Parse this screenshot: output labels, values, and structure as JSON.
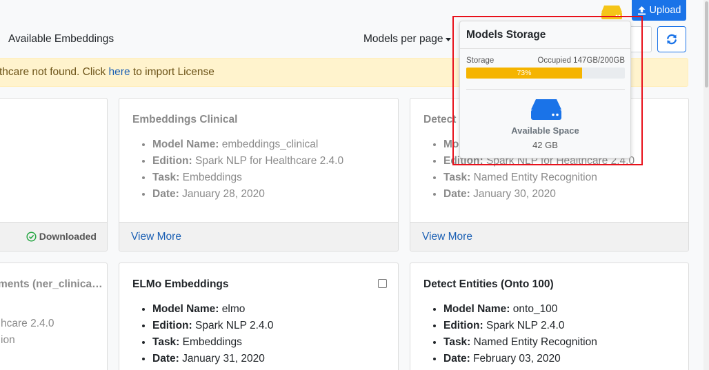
{
  "header": {
    "section_title": "Available Embeddings",
    "per_page_label": "Models per page",
    "upload_label": "Upload"
  },
  "alert": {
    "prefix": "thcare not found. Click ",
    "link": "here",
    "suffix": " to import License"
  },
  "cards": [
    {
      "title": "",
      "items": [],
      "status": "Downloaded"
    },
    {
      "title": "Embeddings Clinical",
      "items": [
        {
          "label": "Model Name:",
          "value": " embeddings_clinical"
        },
        {
          "label": "Edition:",
          "value": " Spark NLP for Healthcare 2.4.0"
        },
        {
          "label": "Task:",
          "value": " Embeddings"
        },
        {
          "label": "Date:",
          "value": " January 28, 2020"
        }
      ],
      "footer_link": "View More"
    },
    {
      "title": "Detect C",
      "items": [
        {
          "label": "Mo",
          "value": ""
        },
        {
          "label": "Edition:",
          "value": " Spark NLP for Healthcare 2.4.0"
        },
        {
          "label": "Task:",
          "value": " Named Entity Recognition"
        },
        {
          "label": "Date:",
          "value": " January 30, 2020"
        }
      ],
      "footer_link": "View More"
    },
    {
      "title": "ments (ner_clinica…",
      "lines": [
        "hcare 2.4.0",
        "ion"
      ]
    },
    {
      "title": "ELMo Embeddings",
      "items": [
        {
          "label": "Model Name:",
          "value": " elmo"
        },
        {
          "label": "Edition:",
          "value": " Spark NLP 2.4.0"
        },
        {
          "label": "Task:",
          "value": " Embeddings"
        },
        {
          "label": "Date:",
          "value": " January 31, 2020"
        }
      ]
    },
    {
      "title": "Detect Entities (Onto 100)",
      "items": [
        {
          "label": "Model Name:",
          "value": " onto_100"
        },
        {
          "label": "Edition:",
          "value": " Spark NLP 2.4.0"
        },
        {
          "label": "Task:",
          "value": " Named Entity Recognition"
        },
        {
          "label": "Date:",
          "value": " February 03, 2020"
        }
      ]
    }
  ],
  "storage": {
    "title": "Models Storage",
    "storage_label": "Storage",
    "occupied_label": "Occupied 147GB/200GB",
    "percent_label": "73%",
    "percent": 73,
    "available_label": "Available Space",
    "available_value": "42 GB"
  },
  "colors": {
    "primary": "#1a73e8",
    "warning_bar": "#f5b400",
    "alert_bg": "#fff3cd",
    "highlight": "#e8101a"
  },
  "icons": {
    "upload": "upload-icon",
    "refresh": "refresh-icon",
    "storage": "hard-drive-icon",
    "downloaded": "check-circle-icon"
  }
}
